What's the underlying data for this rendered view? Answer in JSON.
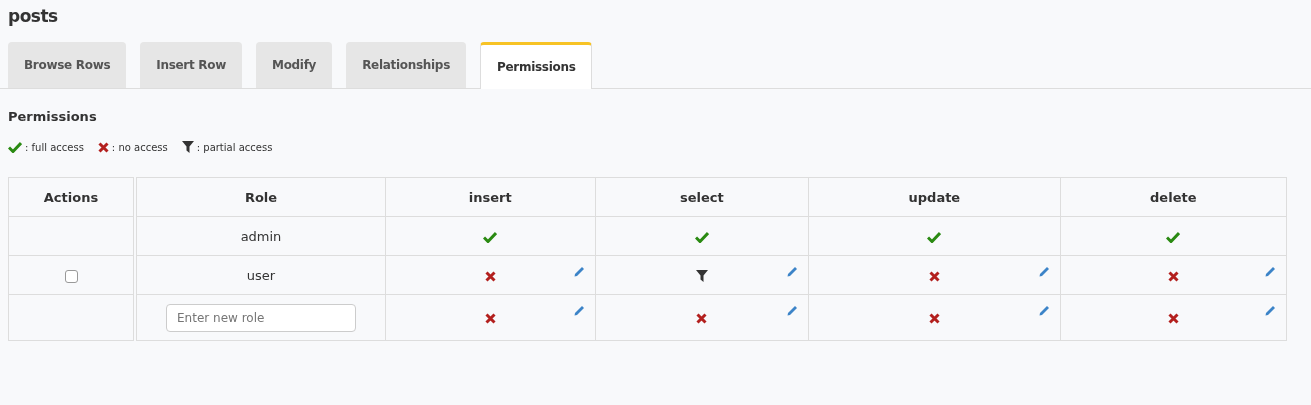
{
  "title": "posts",
  "tabs": [
    {
      "label": "Browse Rows",
      "selected": false
    },
    {
      "label": "Insert Row",
      "selected": false
    },
    {
      "label": "Modify",
      "selected": false
    },
    {
      "label": "Relationships",
      "selected": false
    },
    {
      "label": "Permissions",
      "selected": true
    }
  ],
  "section_title": "Permissions",
  "legend": [
    {
      "kind": "full",
      "label": ": full access"
    },
    {
      "kind": "none",
      "label": ": no access"
    },
    {
      "kind": "partial",
      "label": ": partial access"
    }
  ],
  "table": {
    "columns": [
      "Actions",
      "Role",
      "insert",
      "select",
      "update",
      "delete"
    ],
    "rows": [
      {
        "kind": "role",
        "role": "admin",
        "cells": [
          {
            "kind": "full",
            "editable": false
          },
          {
            "kind": "full",
            "editable": false
          },
          {
            "kind": "full",
            "editable": false
          },
          {
            "kind": "full",
            "editable": false
          }
        ]
      },
      {
        "kind": "role",
        "role": "user",
        "checkbox": {
          "checked": false
        },
        "cells": [
          {
            "kind": "none",
            "editable": true
          },
          {
            "kind": "partial",
            "editable": true
          },
          {
            "kind": "none",
            "editable": true
          },
          {
            "kind": "none",
            "editable": true
          }
        ]
      },
      {
        "kind": "new",
        "placeholder": "Enter new role",
        "cells": [
          {
            "kind": "none",
            "editable": true
          },
          {
            "kind": "none",
            "editable": true
          },
          {
            "kind": "none",
            "editable": true
          },
          {
            "kind": "none",
            "editable": true
          }
        ]
      }
    ]
  }
}
